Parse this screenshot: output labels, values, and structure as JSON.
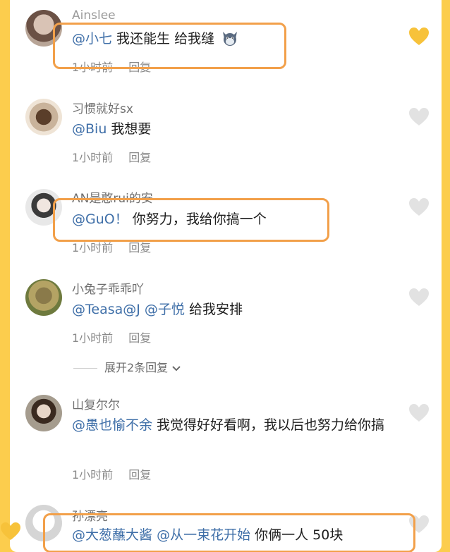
{
  "comments": [
    {
      "username": "Ainslee",
      "mentions": [
        "@小七"
      ],
      "text": " 我还能生 给我缝",
      "emoji_icon": "cat-face-icon",
      "time": "1小时前",
      "reply": "回复",
      "liked": true
    },
    {
      "username": "习惯就好sx",
      "mentions": [
        "@Biu"
      ],
      "text": " 我想要",
      "time": "1小时前",
      "reply": "回复",
      "liked": false
    },
    {
      "username": "AN是憨rui的安",
      "mentions": [
        "@GuO！"
      ],
      "text": " 你努力，我给你搞一个",
      "time": "1小时前",
      "reply": "回复",
      "liked": false
    },
    {
      "username": "小兔子乖乖吖",
      "mentions": [
        "@Teasa@J",
        "@子悦"
      ],
      "text": " 给我安排",
      "time": "1小时前",
      "reply": "回复",
      "liked": false,
      "expand_label": "展开2条回复"
    },
    {
      "username": "山复尔尔",
      "mentions": [
        "@愚也愉不余"
      ],
      "text": " 我觉得好好看啊，我以后也努力给你搞",
      "time": "1小时前",
      "reply": "回复",
      "liked": false
    },
    {
      "username": "孙漂亮",
      "mentions": [
        "@大葱蘸大酱",
        "@从一束花开始"
      ],
      "text": " 你俩一人 50块",
      "liked": false
    }
  ],
  "colors": {
    "background": "#fccd4d",
    "mention": "#3f6fa8",
    "heart_liked": "#f7c23a",
    "heart_unliked": "#e2e2e2",
    "highlight": "#f2a04a"
  }
}
